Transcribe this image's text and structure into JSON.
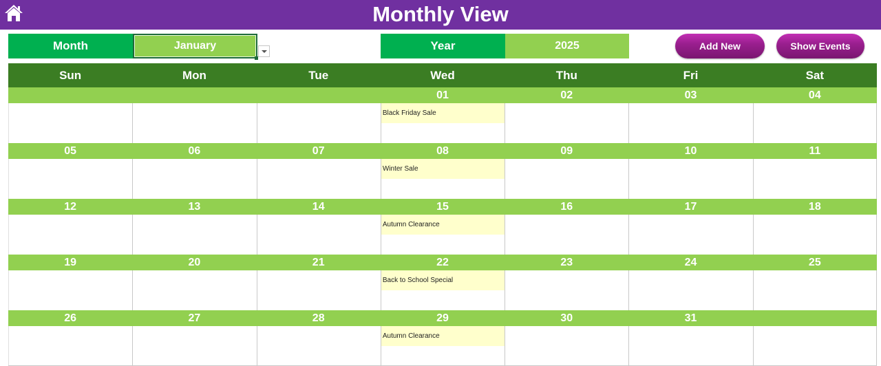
{
  "header": {
    "title": "Monthly View",
    "home_icon": "home-icon"
  },
  "colors": {
    "title_bar": "#7030a0",
    "label_green": "#00b050",
    "value_green": "#92d050",
    "weekday_header": "#3b7d23",
    "event_bg": "#ffffcc",
    "button": "#9a1f8f"
  },
  "controls": {
    "month_label": "Month",
    "month_value": "January",
    "year_label": "Year",
    "year_value": "2025",
    "add_new_label": "Add New",
    "show_events_label": "Show Events"
  },
  "calendar": {
    "weekdays": [
      "Sun",
      "Mon",
      "Tue",
      "Wed",
      "Thu",
      "Fri",
      "Sat"
    ],
    "weeks": [
      {
        "days": [
          "",
          "",
          "",
          "01",
          "02",
          "03",
          "04"
        ],
        "events": [
          "",
          "",
          "",
          "Black Friday Sale",
          "",
          "",
          ""
        ]
      },
      {
        "days": [
          "05",
          "06",
          "07",
          "08",
          "09",
          "10",
          "11"
        ],
        "events": [
          "",
          "",
          "",
          "Winter Sale",
          "",
          "",
          ""
        ]
      },
      {
        "days": [
          "12",
          "13",
          "14",
          "15",
          "16",
          "17",
          "18"
        ],
        "events": [
          "",
          "",
          "",
          "Autumn Clearance",
          "",
          "",
          ""
        ]
      },
      {
        "days": [
          "19",
          "20",
          "21",
          "22",
          "23",
          "24",
          "25"
        ],
        "events": [
          "",
          "",
          "",
          "Back to School Special",
          "",
          "",
          ""
        ]
      },
      {
        "days": [
          "26",
          "27",
          "28",
          "29",
          "30",
          "31",
          ""
        ],
        "events": [
          "",
          "",
          "",
          "Autumn Clearance",
          "",
          "",
          ""
        ]
      }
    ]
  }
}
